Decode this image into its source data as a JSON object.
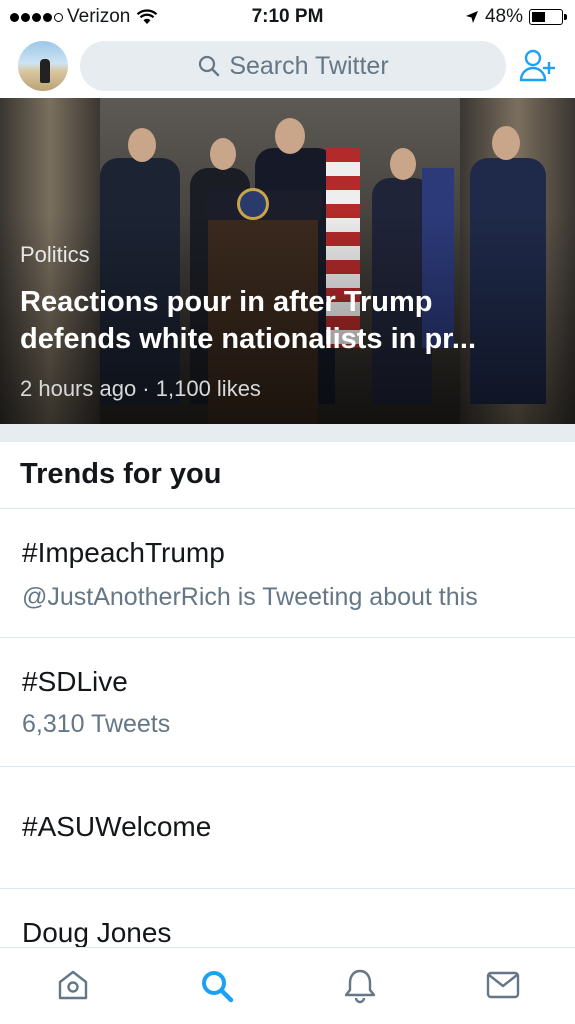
{
  "status_bar": {
    "carrier": "Verizon",
    "time": "7:10 PM",
    "battery": "48%",
    "battery_level": 0.48
  },
  "header": {
    "search_placeholder": "Search Twitter",
    "icons": [
      "search-icon",
      "add-user-icon"
    ]
  },
  "hero": {
    "category": "Politics",
    "headline_line1": "Reactions pour in after Trump",
    "headline_line2": "defends white nationalists in pr...",
    "meta": "2 hours ago · 1,100 likes"
  },
  "trends": {
    "title": "Trends for you",
    "items": [
      {
        "name": "#ImpeachTrump",
        "context": "@JustAnotherRich is Tweeting about this"
      },
      {
        "name": "#SDLive",
        "context": "6,310 Tweets"
      },
      {
        "name": "#ASUWelcome",
        "context": ""
      },
      {
        "name": "Doug Jones",
        "context": ""
      }
    ]
  },
  "tab_bar": {
    "tabs": [
      "home-icon",
      "search-icon",
      "notifications-icon",
      "messages-icon"
    ],
    "active": "search-icon"
  },
  "colors": {
    "accent": "#1da1f2",
    "secondary_text": "#657786",
    "search_bg": "#e6ecf0"
  }
}
